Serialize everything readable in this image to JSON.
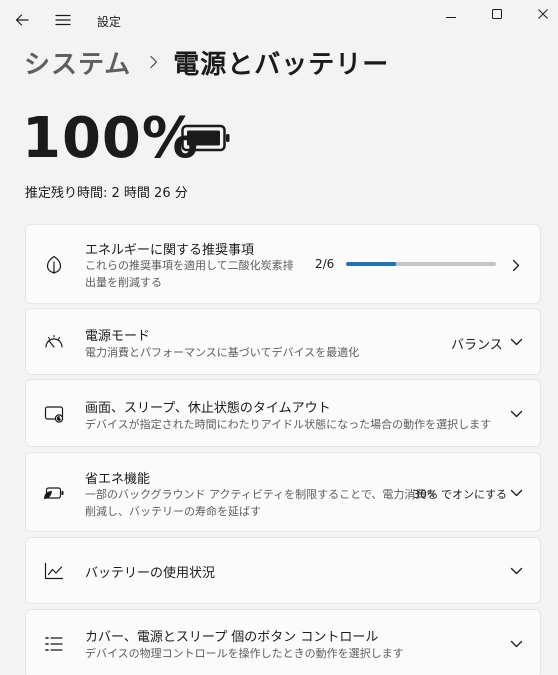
{
  "window": {
    "title": "設定"
  },
  "breadcrumb": {
    "parent": "システム",
    "separator": "›",
    "current": "電源とバッテリー"
  },
  "battery": {
    "percent_label": "100%",
    "remaining": "推定残り時間: 2 時間 26 分"
  },
  "cards": {
    "recommendations": {
      "title": "エネルギーに関する推奨事項",
      "desc_line1": "これらの推奨事項を適用して二酸化炭素排",
      "desc_line2": "出量を削減する",
      "progress_label": "2/6",
      "progress_value": 2,
      "progress_max": 6
    },
    "power_mode": {
      "title": "電源モード",
      "desc": "電力消費とパフォーマンスに基づいてデバイスを最適化",
      "value": "バランス"
    },
    "screen_sleep": {
      "title": "画面、スリープ、休止状態のタイムアウト",
      "desc": "デバイスが指定された時間にわたりアイドル状態になった場合の動作を選択します"
    },
    "energy_saver": {
      "title": "省エネ機能",
      "desc_line1": "一部のバックグラウンド アクティビティを制限することで、電力消費を",
      "desc_line2": "削減し、バッテリーの寿命を延ばす",
      "value": "30% でオンにする"
    },
    "battery_usage": {
      "title": "バッテリーの使用状況"
    },
    "lid_buttons": {
      "title": "カバー、電源とスリープ 個のボタン コントロール",
      "desc": "デバイスの物理コントロールを操作したときの動作を選択します"
    }
  },
  "colors": {
    "accent": "#2173b8",
    "background": "#f3f3f3",
    "card": "#fbfbfb"
  }
}
